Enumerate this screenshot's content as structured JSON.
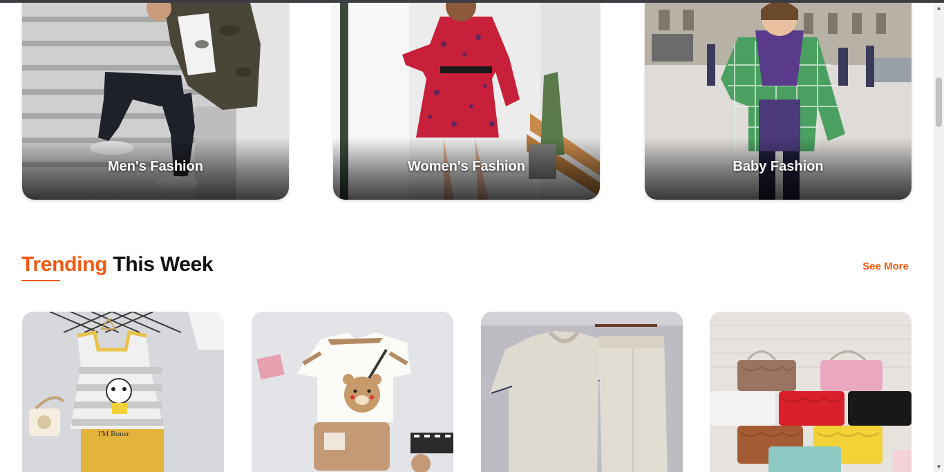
{
  "categories": [
    {
      "label": "Men's Fashion"
    },
    {
      "label": "Women's Fashion"
    },
    {
      "label": "Baby Fashion"
    }
  ],
  "trending": {
    "title_accent": "Trending",
    "title_rest": "This Week",
    "see_more_label": "See More"
  },
  "products": [
    {
      "name": "kids-tank-top-set",
      "print_text": "I'M Boner"
    },
    {
      "name": "bear-tshirt-shorts-set"
    },
    {
      "name": "linen-tshirt-pants-set"
    },
    {
      "name": "quilted-handbags"
    }
  ],
  "colors": {
    "accent": "#f05a14",
    "heading": "#111111"
  },
  "icons": {
    "scroll_up": "scroll-up-arrow-icon",
    "scroll_down": "scroll-down-arrow-icon"
  }
}
